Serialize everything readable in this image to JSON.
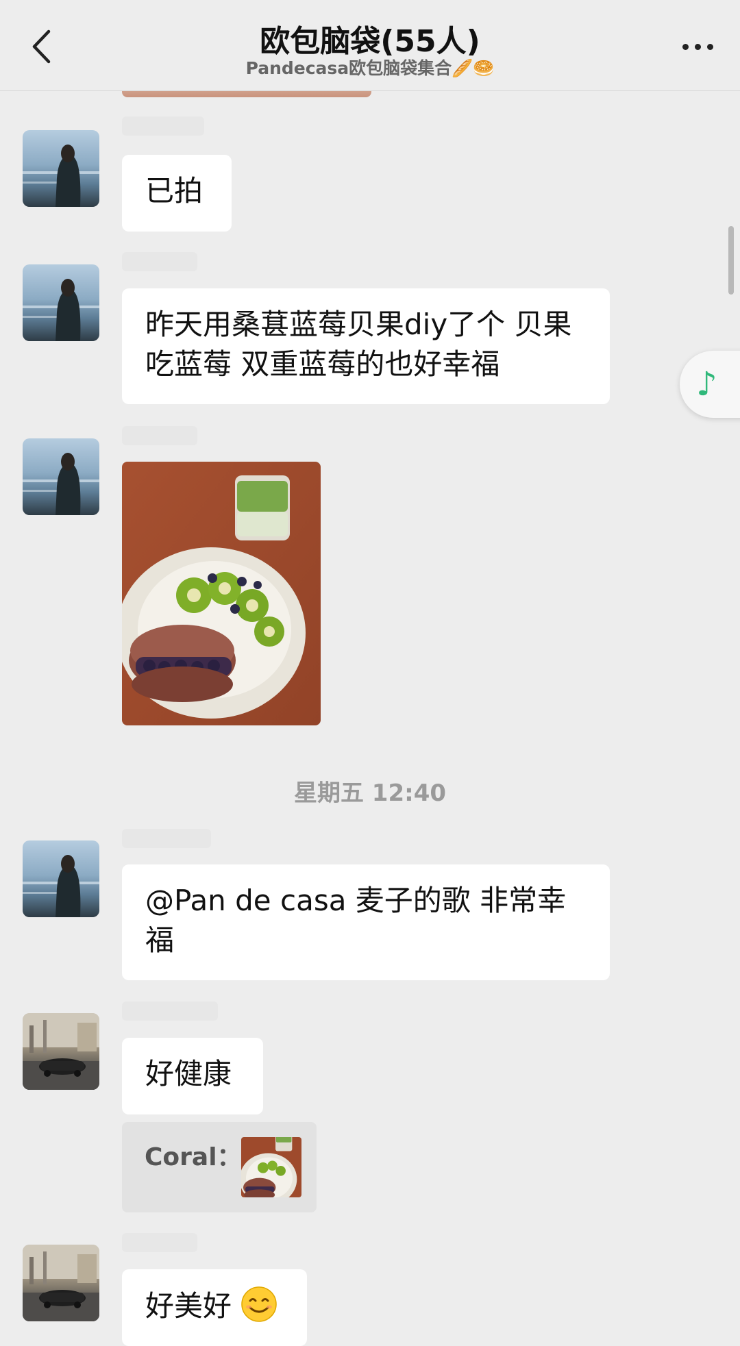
{
  "header": {
    "title": "欧包脑袋(55人)",
    "subtitle": "Pandecasa欧包脑袋集合🥖🥯"
  },
  "messages": [
    {
      "text": "已拍"
    },
    {
      "text": "昨天用桑葚蓝莓贝果diy了个 贝果吃蓝莓 双重蓝莓的也好幸福"
    },
    {
      "text": "@Pan de casa 麦子的歌 非常幸福"
    },
    {
      "text": "好健康"
    },
    {
      "text": "好美好"
    }
  ],
  "timestamp": "星期五 12:40",
  "quote": {
    "label": "Coral："
  },
  "icons": {
    "back": "chevron-left-icon",
    "more": "more-dots-icon",
    "music": "music-note-icon",
    "emoji": "smiling-face-emoji"
  },
  "colors": {
    "background": "#ededed",
    "bubble": "#ffffff",
    "music_accent": "#2fb87a"
  }
}
